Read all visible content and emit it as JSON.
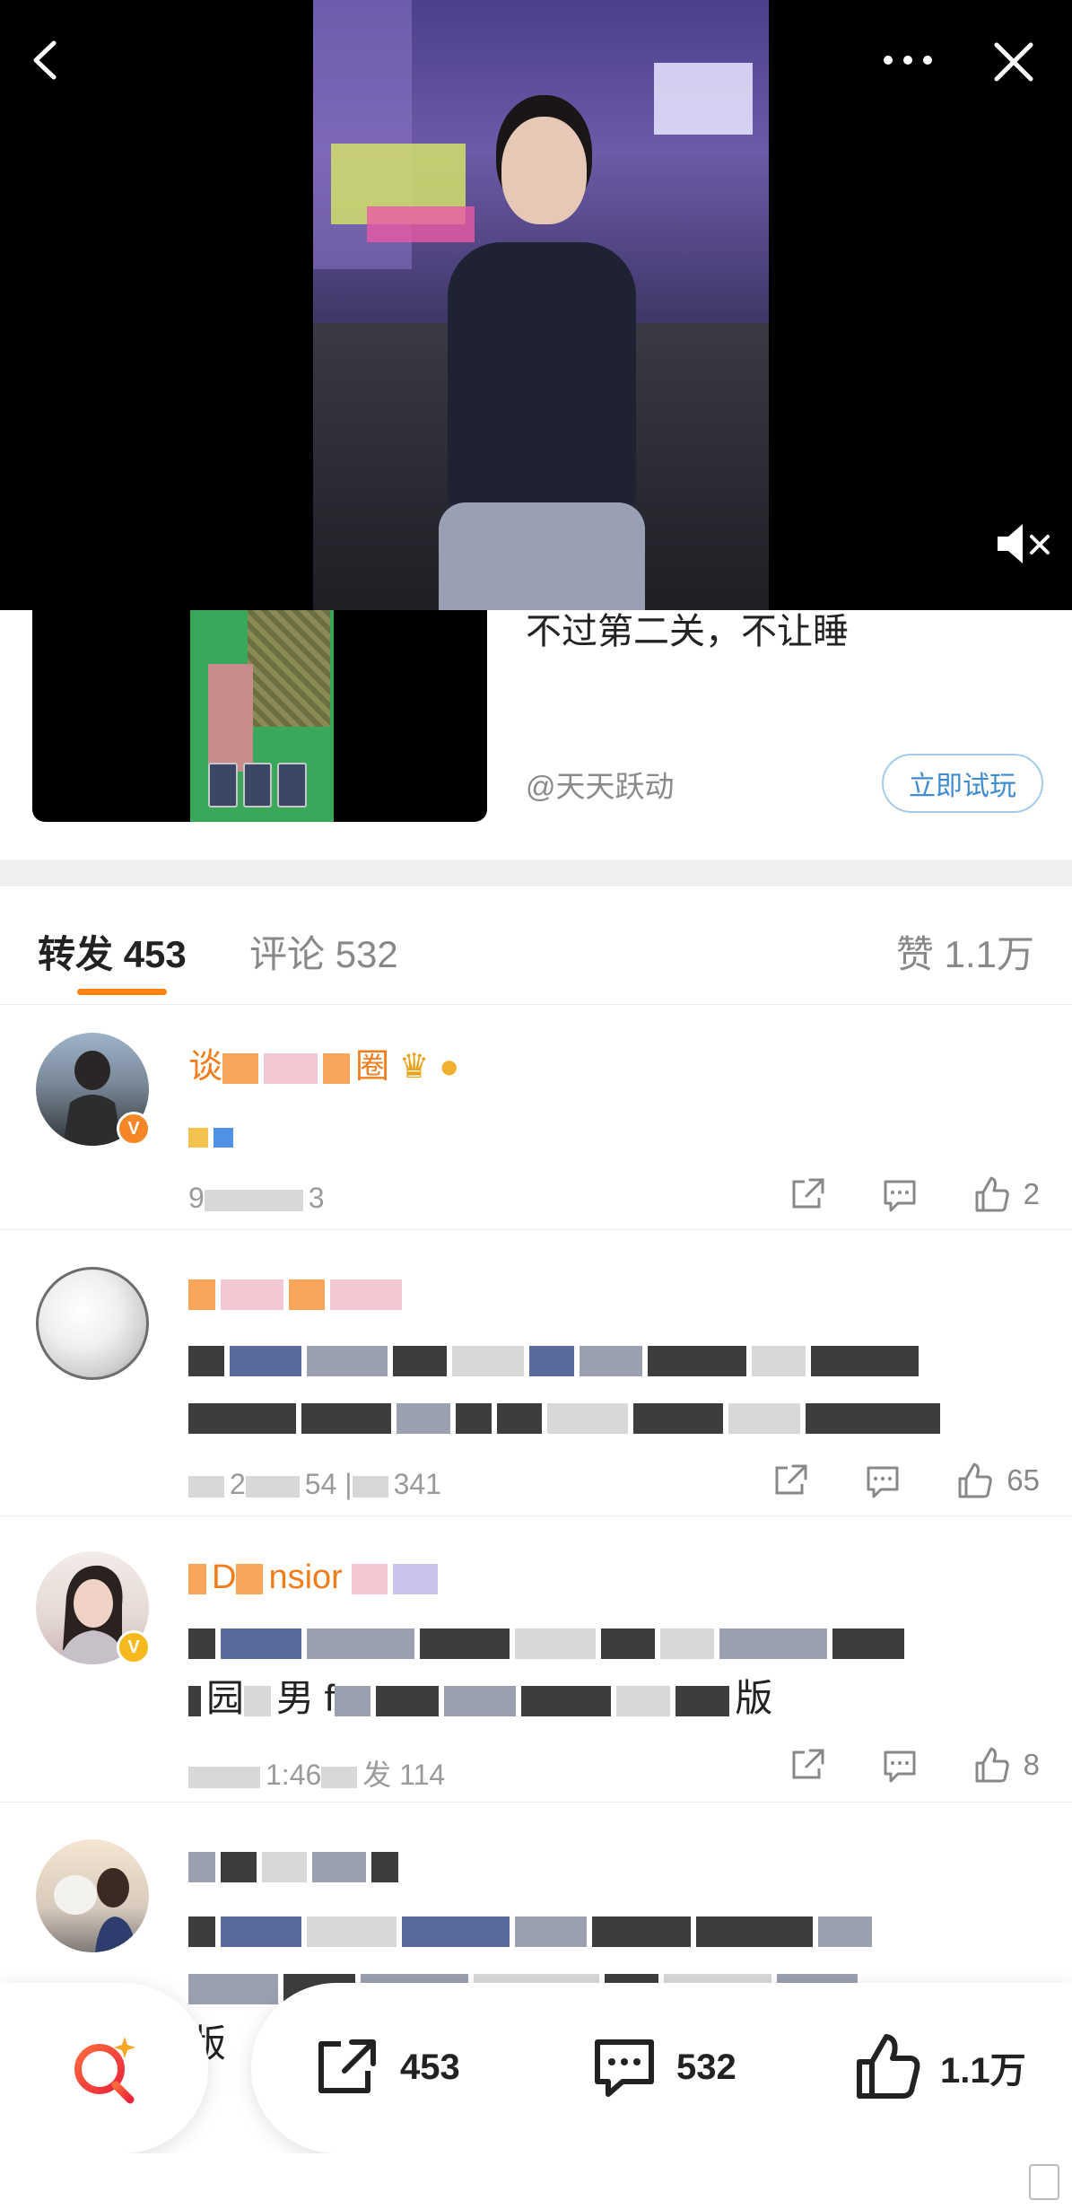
{
  "ad": {
    "title": "不过第二关，不让睡",
    "source": "@天天跃动",
    "button": "立即试玩"
  },
  "tabs": {
    "repost_label": "转发",
    "repost_count": "453",
    "comment_label": "评论",
    "comment_count": "532",
    "like_label": "赞",
    "like_count": "1.1万"
  },
  "feed": [
    {
      "name_fragment": "谈",
      "name_tail": "圈",
      "meta": "9",
      "meta_tail": "3",
      "like_count": "2"
    },
    {
      "name_fragment": "",
      "meta": "2",
      "meta_mid": "54 |",
      "meta_tail": "341",
      "like_count": "65"
    },
    {
      "name_fragment": "D",
      "name_tail": "nsior",
      "content_line2_a": "园",
      "content_line2_b": "男 f",
      "content_line2_c": "版",
      "meta_mid": "1:46",
      "meta_tail": "发 114",
      "like_count": "8"
    },
    {
      "content_line3": "版"
    }
  ],
  "bottom_bar": {
    "repost_count": "453",
    "comment_count": "532",
    "like_count": "1.1万"
  },
  "colors": {
    "accent": "#ff8200",
    "username": "#f27d1c",
    "link_button": "#3f8bd0"
  }
}
